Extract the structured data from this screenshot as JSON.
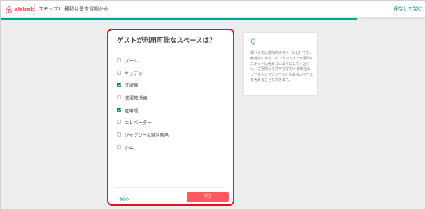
{
  "header": {
    "logo_text": "airbnb",
    "step_title": "ステップ1: 最初は基本情報から",
    "save_exit": "保存して閉じ"
  },
  "progress": {
    "fraction": 0.84
  },
  "card": {
    "title": "ゲストが利用可能なスペースは？",
    "options": [
      {
        "label": "プール",
        "checked": false
      },
      {
        "label": "キッチン",
        "checked": false
      },
      {
        "label": "洗濯機",
        "checked": true
      },
      {
        "label": "洗濯乾燥機",
        "checked": false
      },
      {
        "label": "駐車場",
        "checked": true
      },
      {
        "label": "エレベーター",
        "checked": false
      },
      {
        "label": "ジャグジー&温浴風呂",
        "checked": false
      },
      {
        "label": "ジム",
        "checked": false
      }
    ],
    "back_label": "戻る",
    "done_label": "完了"
  },
  "tip": {
    "icon": "lightbulb-icon",
    "text": "選べるのは敷地内のスペースだけです。敷地外にあるコインランドリーや近所のスポットは含めないようにしてください。ご近所から許可を得ている場合は、プールやジャグジーなどの共有スペースを含めることもできます。"
  },
  "colors": {
    "brand": "#ff5a5f",
    "accent": "#008489",
    "progress": "#00a699",
    "highlight_border": "#e8101d"
  }
}
